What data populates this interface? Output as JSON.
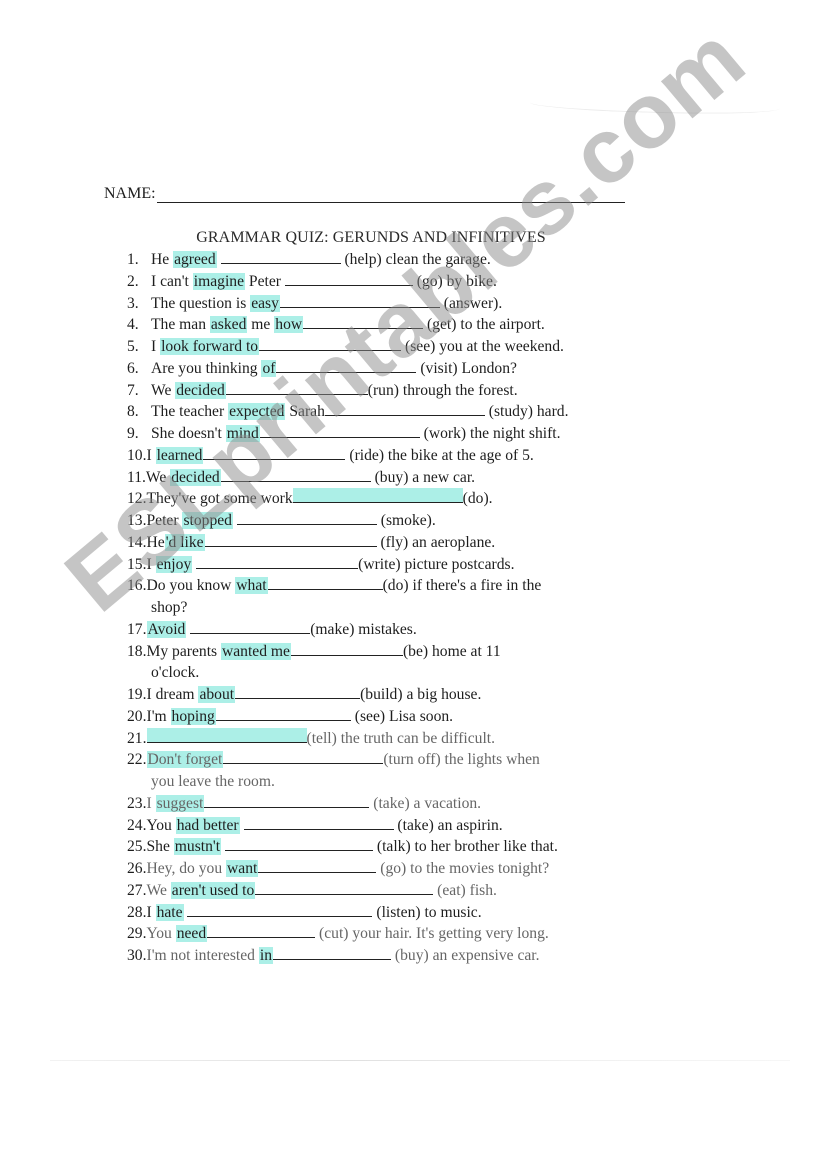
{
  "worksheet": {
    "name_label": "NAME:",
    "title": "GRAMMAR QUIZ: GERUNDS AND INFINITIVES",
    "watermark": "ESLprintables.com",
    "highlight_color": "#67e2d4",
    "items": [
      {
        "num": "1.",
        "parts": [
          [
            "t",
            "He "
          ],
          [
            "h",
            "agreed"
          ],
          [
            "t",
            " "
          ],
          [
            "b",
            ""
          ],
          [
            "t",
            " (help) clean the garage."
          ]
        ]
      },
      {
        "num": "2.",
        "parts": [
          [
            "t",
            "I can't "
          ],
          [
            "h",
            "imagine"
          ],
          [
            "t",
            " Peter "
          ],
          [
            "b",
            ""
          ],
          [
            "t",
            " (go) by bike."
          ]
        ]
      },
      {
        "num": "3.",
        "parts": [
          [
            "t",
            "The question is "
          ],
          [
            "h",
            "easy"
          ],
          [
            "b",
            ""
          ],
          [
            "t",
            " (answer)."
          ]
        ]
      },
      {
        "num": "4.",
        "parts": [
          [
            "t",
            "The man "
          ],
          [
            "h",
            "asked"
          ],
          [
            "t",
            " me "
          ],
          [
            "h",
            "how"
          ],
          [
            "b",
            ""
          ],
          [
            "t",
            " (get) to the airport."
          ]
        ]
      },
      {
        "num": "5.",
        "parts": [
          [
            "t",
            "I "
          ],
          [
            "h",
            "look forward to"
          ],
          [
            "b",
            ""
          ],
          [
            "t",
            " (see) you at the weekend."
          ]
        ]
      },
      {
        "num": "6.",
        "parts": [
          [
            "t",
            "Are you thinking "
          ],
          [
            "h",
            "of"
          ],
          [
            "b",
            ""
          ],
          [
            "t",
            " (visit) London?"
          ]
        ]
      },
      {
        "num": "7.",
        "parts": [
          [
            "t",
            "We "
          ],
          [
            "h",
            "decided"
          ],
          [
            "b",
            ""
          ],
          [
            "t",
            "(run) through the forest."
          ]
        ]
      },
      {
        "num": "8.",
        "parts": [
          [
            "t",
            "The teacher "
          ],
          [
            "h",
            "expected"
          ],
          [
            "t",
            " Sarah"
          ],
          [
            "b",
            ""
          ],
          [
            "t",
            " (study) hard."
          ]
        ]
      },
      {
        "num": "9.",
        "parts": [
          [
            "t",
            "She doesn't "
          ],
          [
            "h",
            "mind"
          ],
          [
            "b",
            ""
          ],
          [
            "t",
            " (work) the night shift."
          ]
        ]
      },
      {
        "num": "10.",
        "parts": [
          [
            "t",
            "I "
          ],
          [
            "h",
            "learned"
          ],
          [
            "b",
            ""
          ],
          [
            "t",
            " (ride) the bike at the age of 5."
          ]
        ]
      },
      {
        "num": "11.",
        "parts": [
          [
            "t",
            "We "
          ],
          [
            "h",
            "decided"
          ],
          [
            "b",
            ""
          ],
          [
            "t",
            " (buy) a new car."
          ]
        ]
      },
      {
        "num": "12.",
        "parts": [
          [
            "t",
            "They've got some work"
          ],
          [
            "hb",
            ""
          ],
          [
            "t",
            "(do)."
          ]
        ]
      },
      {
        "num": "13.",
        "parts": [
          [
            "t",
            "Peter "
          ],
          [
            "h",
            "stopped"
          ],
          [
            "t",
            " "
          ],
          [
            "b",
            ""
          ],
          [
            "t",
            " (smoke)."
          ]
        ]
      },
      {
        "num": "14.",
        "parts": [
          [
            "t",
            "He"
          ],
          [
            "h",
            "'d like"
          ],
          [
            "b",
            ""
          ],
          [
            "t",
            " (fly) an aeroplane."
          ]
        ]
      },
      {
        "num": "15.",
        "parts": [
          [
            "t",
            "I "
          ],
          [
            "h",
            "enjoy"
          ],
          [
            "t",
            " "
          ],
          [
            "b",
            ""
          ],
          [
            "t",
            "(write) picture postcards."
          ]
        ]
      },
      {
        "num": "16.",
        "parts": [
          [
            "t",
            "Do you know "
          ],
          [
            "h",
            "what"
          ],
          [
            "b",
            ""
          ],
          [
            "t",
            "(do) if there's a fire in the"
          ]
        ],
        "cont": "shop?"
      },
      {
        "num": "17.",
        "parts": [
          [
            "h",
            "Avoid"
          ],
          [
            "t",
            " "
          ],
          [
            "b",
            ""
          ],
          [
            "t",
            "(make) mistakes."
          ]
        ]
      },
      {
        "num": "18.",
        "parts": [
          [
            "t",
            "My parents "
          ],
          [
            "h",
            "wanted me"
          ],
          [
            "b",
            ""
          ],
          [
            "t",
            "(be) home at 11"
          ]
        ],
        "cont": "o'clock."
      },
      {
        "num": "19.",
        "parts": [
          [
            "t",
            "I dream "
          ],
          [
            "h",
            "about"
          ],
          [
            "b",
            ""
          ],
          [
            "t",
            "(build) a big house."
          ]
        ]
      },
      {
        "num": "20.",
        "parts": [
          [
            "t",
            "I'm "
          ],
          [
            "h",
            "hoping"
          ],
          [
            "b",
            ""
          ],
          [
            "t",
            " (see) Lisa soon."
          ]
        ]
      },
      {
        "num": "21.",
        "parts": [
          [
            "hb",
            ""
          ],
          [
            "f",
            "(tell) the truth can be difficult."
          ]
        ]
      },
      {
        "num": "22.",
        "parts": [
          [
            "fh",
            "Don't forget"
          ],
          [
            "b",
            ""
          ],
          [
            "f",
            "(turn off) the lights when"
          ]
        ],
        "cont": "you leave the room.",
        "cont_faded": true
      },
      {
        "num": "23.",
        "parts": [
          [
            "f",
            "I "
          ],
          [
            "fh",
            "suggest"
          ],
          [
            "b",
            ""
          ],
          [
            "f",
            " (take) a vacation."
          ]
        ]
      },
      {
        "num": "24.",
        "parts": [
          [
            "t",
            "You "
          ],
          [
            "h",
            "had better"
          ],
          [
            "t",
            " "
          ],
          [
            "b",
            ""
          ],
          [
            "t",
            " (take) an aspirin."
          ]
        ]
      },
      {
        "num": "25.",
        "parts": [
          [
            "t",
            "She "
          ],
          [
            "h",
            "mustn't"
          ],
          [
            "t",
            " "
          ],
          [
            "b",
            ""
          ],
          [
            "t",
            " (talk) to her brother like that."
          ]
        ]
      },
      {
        "num": "26.",
        "parts": [
          [
            "f",
            "Hey, do you "
          ],
          [
            "h",
            "want"
          ],
          [
            "b",
            ""
          ],
          [
            "f",
            " (go) to the movies tonight?"
          ]
        ]
      },
      {
        "num": "27.",
        "parts": [
          [
            "f",
            "We "
          ],
          [
            "h",
            "aren't used to"
          ],
          [
            "b",
            ""
          ],
          [
            "f",
            " (eat) fish."
          ]
        ]
      },
      {
        "num": "28.",
        "parts": [
          [
            "t",
            "I "
          ],
          [
            "h",
            "hate"
          ],
          [
            "t",
            " "
          ],
          [
            "b",
            ""
          ],
          [
            "t",
            " (listen) to music."
          ]
        ]
      },
      {
        "num": "29.",
        "parts": [
          [
            "f",
            "You "
          ],
          [
            "h",
            "need"
          ],
          [
            "b",
            ""
          ],
          [
            "f",
            " (cut) your hair. It's getting very long."
          ]
        ]
      },
      {
        "num": "30.",
        "parts": [
          [
            "f",
            "I'm not interested "
          ],
          [
            "h",
            "in"
          ],
          [
            "b",
            ""
          ],
          [
            "f",
            " (buy) an expensive car."
          ]
        ]
      }
    ]
  }
}
